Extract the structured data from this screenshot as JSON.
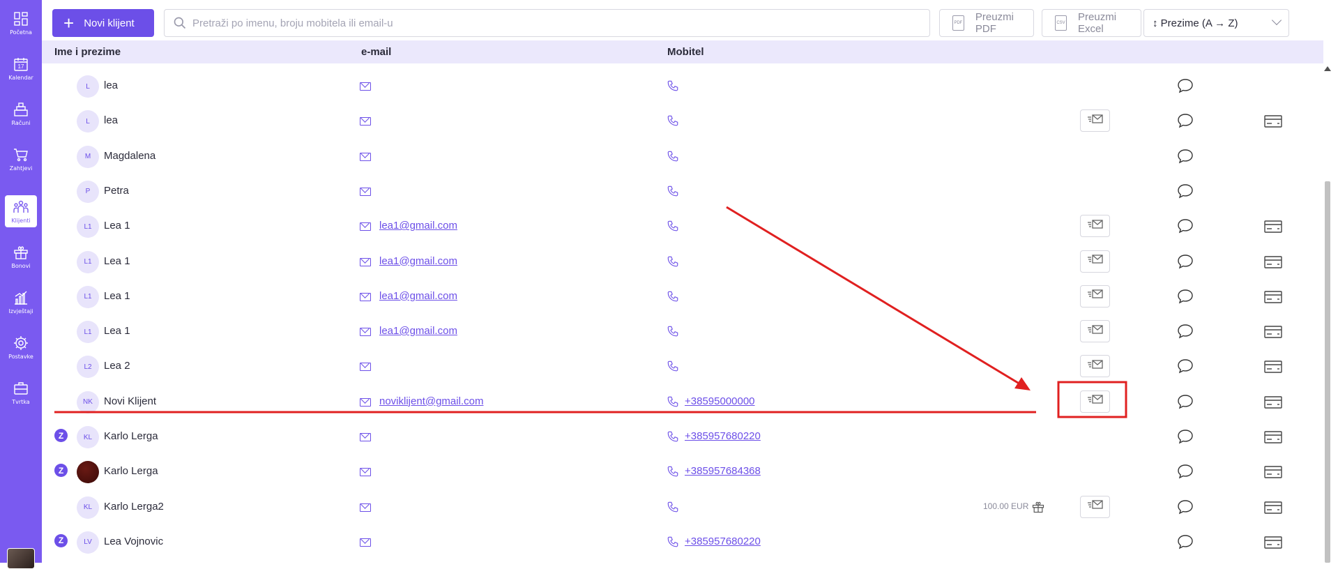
{
  "sidebar": {
    "items": [
      {
        "label": "Početna",
        "icon": "dashboard-icon",
        "active": false
      },
      {
        "label": "Kalendar",
        "icon": "calendar-icon",
        "active": false,
        "day": "17"
      },
      {
        "label": "Računi",
        "icon": "cash-register-icon",
        "active": false
      },
      {
        "label": "Zahtjevi",
        "icon": "cart-icon",
        "active": false
      },
      {
        "label": "Klijenti",
        "icon": "people-icon",
        "active": true
      },
      {
        "label": "Bonovi",
        "icon": "gift-icon",
        "active": false
      },
      {
        "label": "Izvještaji",
        "icon": "chart-icon",
        "active": false
      },
      {
        "label": "Postavke",
        "icon": "gear-icon",
        "active": false
      },
      {
        "label": "Tvrtka",
        "icon": "briefcase-icon",
        "active": false
      }
    ]
  },
  "toolbar": {
    "new_client_label": "Novi klijent",
    "search_placeholder": "Pretraži po imenu, broju mobitela ili email-u",
    "pdf_label": "Preuzmi PDF",
    "pdf_icon_text": "PDF",
    "excel_label": "Preuzmi Excel",
    "excel_icon_text": "CSV",
    "sort_value": "↕ Prezime (A → Z)"
  },
  "table": {
    "headers": {
      "name": "Ime i prezime",
      "email": "e-mail",
      "mobile": "Mobitel"
    },
    "rows": [
      {
        "initials": "L",
        "name": "lea",
        "email": "",
        "phone": "",
        "send": false,
        "card": false,
        "z": false,
        "photo": false,
        "voucher": ""
      },
      {
        "initials": "L",
        "name": "lea",
        "email": "",
        "phone": "",
        "send": true,
        "card": true,
        "z": false,
        "photo": false,
        "voucher": ""
      },
      {
        "initials": "M",
        "name": "Magdalena",
        "email": "",
        "phone": "",
        "send": false,
        "card": false,
        "z": false,
        "photo": false,
        "voucher": ""
      },
      {
        "initials": "P",
        "name": "Petra",
        "email": "",
        "phone": "",
        "send": false,
        "card": false,
        "z": false,
        "photo": false,
        "voucher": ""
      },
      {
        "initials": "L1",
        "name": "Lea 1",
        "email": "lea1@gmail.com",
        "phone": "",
        "send": true,
        "card": true,
        "z": false,
        "photo": false,
        "voucher": ""
      },
      {
        "initials": "L1",
        "name": "Lea 1",
        "email": "lea1@gmail.com",
        "phone": "",
        "send": true,
        "card": true,
        "z": false,
        "photo": false,
        "voucher": ""
      },
      {
        "initials": "L1",
        "name": "Lea 1",
        "email": "lea1@gmail.com",
        "phone": "",
        "send": true,
        "card": true,
        "z": false,
        "photo": false,
        "voucher": ""
      },
      {
        "initials": "L1",
        "name": "Lea 1",
        "email": "lea1@gmail.com",
        "phone": "",
        "send": true,
        "card": true,
        "z": false,
        "photo": false,
        "voucher": ""
      },
      {
        "initials": "L2",
        "name": "Lea 2",
        "email": "",
        "phone": "",
        "send": true,
        "card": true,
        "z": false,
        "photo": false,
        "voucher": ""
      },
      {
        "initials": "NK",
        "name": "Novi Klijent",
        "email": "noviklijent@gmail.com",
        "phone": "+38595000000",
        "send": true,
        "card": true,
        "z": false,
        "photo": false,
        "voucher": ""
      },
      {
        "initials": "KL",
        "name": "Karlo Lerga",
        "email": "",
        "phone": "+385957680220",
        "send": false,
        "card": true,
        "z": true,
        "photo": false,
        "voucher": ""
      },
      {
        "initials": "",
        "name": "Karlo Lerga",
        "email": "",
        "phone": "+385957684368",
        "send": false,
        "card": true,
        "z": true,
        "photo": true,
        "voucher": ""
      },
      {
        "initials": "KL",
        "name": "Karlo Lerga2",
        "email": "",
        "phone": "",
        "send": true,
        "card": true,
        "z": false,
        "photo": false,
        "voucher": "100.00 EUR"
      },
      {
        "initials": "LV",
        "name": "Lea Vojnovic",
        "email": "",
        "phone": "+385957680220",
        "send": false,
        "card": true,
        "z": true,
        "photo": false,
        "voucher": ""
      }
    ]
  },
  "colors": {
    "accent": "#6c4fe8",
    "sidebar": "#7a5af0",
    "header_bg": "#ebe8fc",
    "annotation": "#e02020"
  }
}
